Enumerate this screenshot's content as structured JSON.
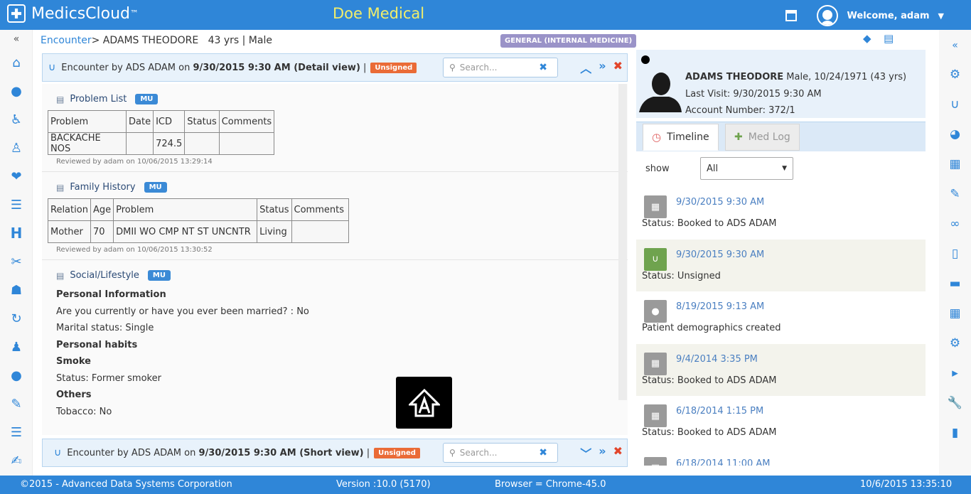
{
  "header": {
    "app_name": "MedicsCloud",
    "tm": "™",
    "org": "Doe Medical",
    "welcome": "Welcome, adam"
  },
  "breadcrumb": {
    "link": "Encounter",
    "patient": "> ADAMS THEODORE",
    "age": "43 yrs",
    "sep": "|",
    "sex": "Male"
  },
  "specialty": "GENERAL (INTERNAL MEDICINE)",
  "encounter_detail": {
    "prefix": "Encounter by ADS ADAM on ",
    "datetime": "9/30/2015 9:30 AM (Detail view)",
    "sep": "|",
    "status": "Unsigned",
    "search_placeholder": "Search..."
  },
  "encounter_short": {
    "prefix": "Encounter by ADS ADAM on ",
    "datetime": "9/30/2015 9:30 AM (Short view)",
    "sep": "|",
    "status": "Unsigned",
    "search_placeholder": "Search..."
  },
  "problem_list": {
    "title": "Problem List",
    "badge": "MU",
    "headers": [
      "Problem",
      "Date",
      "ICD",
      "Status",
      "Comments"
    ],
    "row": [
      "BACKACHE NOS",
      "",
      "724.5",
      "",
      ""
    ],
    "reviewed": "Reviewed by adam on 10/06/2015 13:29:14"
  },
  "family_history": {
    "title": "Family History",
    "badge": "MU",
    "headers": [
      "Relation",
      "Age",
      "Problem",
      "Status",
      "Comments"
    ],
    "row": [
      "Mother",
      "70",
      "DMII WO CMP NT ST UNCNTR",
      "Living",
      ""
    ],
    "reviewed": "Reviewed by adam on 10/06/2015 13:30:52"
  },
  "social": {
    "title": "Social/Lifestyle",
    "badge": "MU",
    "lines": [
      "Personal Information",
      "Are you currently or have you ever been married? : No",
      "Marital status: Single",
      "Personal habits",
      "Smoke",
      "Status: Former smoker",
      "Others",
      "Tobacco: No"
    ]
  },
  "patient": {
    "name": "ADAMS THEODORE",
    "demo": " Male, 10/24/1971 (43 yrs)",
    "last_visit": "Last Visit: 9/30/2015 9:30 AM",
    "account": "Account Number: 372/1"
  },
  "tabs": {
    "timeline": "Timeline",
    "medlog": "Med Log"
  },
  "filter": {
    "label": "show",
    "value": "All"
  },
  "timeline": [
    {
      "date": "9/30/2015 9:30 AM",
      "status": "Status: Booked to ADS ADAM",
      "icon": "calendar-icon"
    },
    {
      "date": "9/30/2015 9:30 AM",
      "status": "Status: Unsigned",
      "icon": "stethoscope-icon"
    },
    {
      "date": "8/19/2015 9:13 AM",
      "status": "Patient demographics created",
      "icon": "user-icon"
    },
    {
      "date": "9/4/2014 3:35 PM",
      "status": "Status: Booked to ADS ADAM",
      "icon": "calendar-icon"
    },
    {
      "date": "6/18/2014 1:15 PM",
      "status": "Status: Booked to ADS ADAM",
      "icon": "calendar-icon"
    },
    {
      "date": "6/18/2014 11:00 AM",
      "status": "",
      "icon": "calendar-icon"
    }
  ],
  "footer": {
    "copyright": "©2015 - Advanced Data Systems Corporation",
    "version": "Version :10.0 (5170)",
    "browser": "Browser = Chrome-45.0",
    "datetime": "10/6/2015 13:35:10"
  },
  "colors": {
    "brand": "#2f86d8",
    "org_title": "#f2ee6a",
    "unsigned": "#ea6b36",
    "mu_badge": "#3b8ad6",
    "specialty": "#9a93c8"
  }
}
